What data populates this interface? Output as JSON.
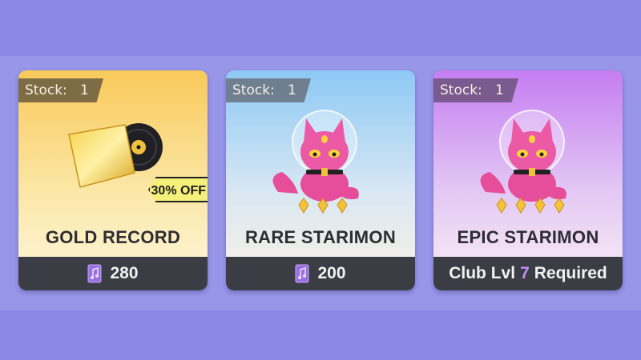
{
  "shop": {
    "cards": [
      {
        "stock_label": "Stock:",
        "stock_value": "1",
        "title": "GOLD RECORD",
        "badge": "30% OFF",
        "price": "280",
        "price_icon": "music-note-ticket-icon",
        "item_icon": "gold-record-icon"
      },
      {
        "stock_label": "Stock:",
        "stock_value": "1",
        "title": "RARE STARIMON",
        "price": "200",
        "price_icon": "music-note-ticket-icon",
        "item_icon": "pink-cat-starimon-icon",
        "stars": 3
      },
      {
        "stock_label": "Stock:",
        "stock_value": "1",
        "title": "EPIC STARIMON",
        "requirement_prefix": "Club Lvl",
        "requirement_level": "7",
        "requirement_suffix": "Required",
        "item_icon": "pink-cat-starimon-icon",
        "stars": 4
      }
    ]
  },
  "colors": {
    "background": "#8b88e3",
    "footer": "#3b3d45",
    "level_highlight": "#c58cf5",
    "badge": "#f5f07a"
  }
}
